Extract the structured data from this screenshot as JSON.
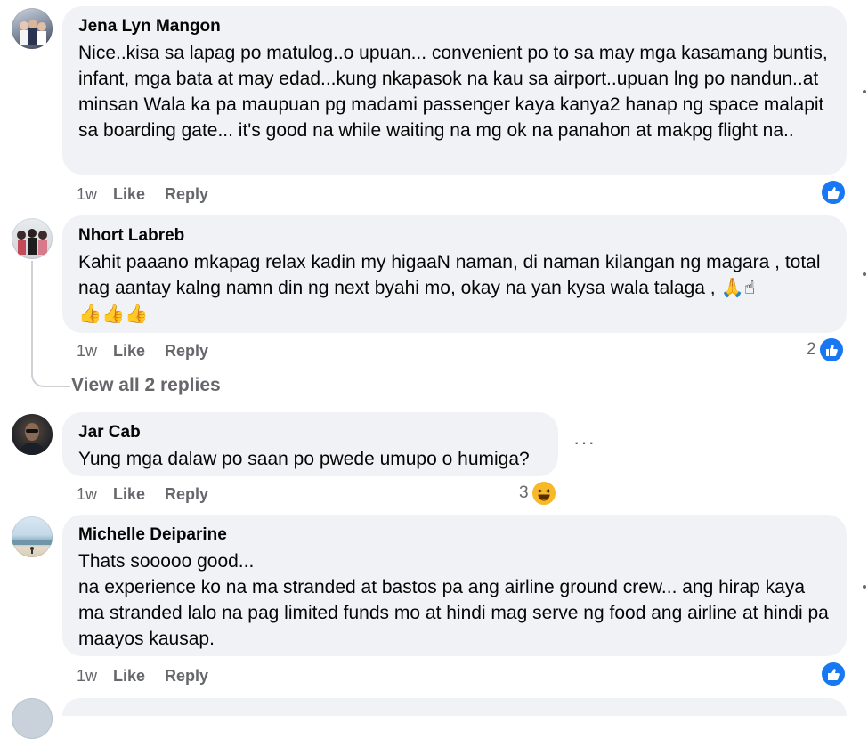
{
  "comments": [
    {
      "author": "Jena Lyn Mangon",
      "text": "Nice..kisa sa lapag po matulog..o upuan... convenient po to sa may mga kasamang buntis, infant, mga bata at may edad...kung nkapasok na kau sa airport..upuan lng po nandun..at minsan Wala ka pa maupuan pg madami passenger kaya kanya2 hanap ng space malapit sa boarding gate... it's good na while waiting na mg ok na panahon at makpg flight na..",
      "time": "1w",
      "like_label": "Like",
      "reply_label": "Reply",
      "reaction_count": ""
    },
    {
      "author": "Nhort Labreb",
      "text": "Kahit paaano mkapag relax kadin my higaaN naman, di naman kilangan ng magara , total nag aantay kalng namn din ng next byahi mo, okay na yan kysa wala talaga , 🙏☝",
      "emojis": "👍👍👍",
      "time": "1w",
      "like_label": "Like",
      "reply_label": "Reply",
      "reaction_count": "2",
      "view_replies": "View all 2 replies"
    },
    {
      "author": "Jar Cab",
      "text": "Yung mga dalaw po saan po pwede umupo o humiga?",
      "time": "1w",
      "like_label": "Like",
      "reply_label": "Reply",
      "reaction_count": "3",
      "more": "···"
    },
    {
      "author": "Michelle Deiparine",
      "text": "Thats sooooo good...\nna experience ko na ma stranded at bastos pa ang airline ground crew... ang hirap kaya ma stranded lalo na pag limited funds mo at hindi mag serve ng food ang airline at hindi pa maayos kausap.",
      "time": "1w",
      "like_label": "Like",
      "reply_label": "Reply",
      "reaction_count": ""
    }
  ],
  "colors": {
    "bubble": "#f0f2f5",
    "secondary_text": "#65676b",
    "like_blue": "#1877f2"
  }
}
